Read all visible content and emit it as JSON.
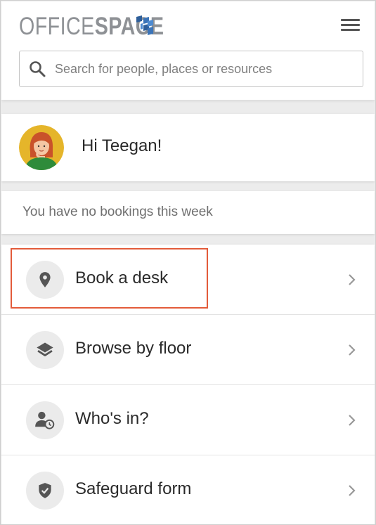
{
  "header": {
    "logo": {
      "text_part1": "OFFICE",
      "text_part2": "SPACE",
      "cube_colors": [
        "#2f5f9a",
        "#3b74b8",
        "#4d8ad0"
      ]
    },
    "menu_icon": "hamburger-menu-icon"
  },
  "search": {
    "placeholder": "Search for people, places or resources",
    "value": "",
    "icon": "search-icon"
  },
  "greeting": {
    "text": "Hi Teegan!",
    "avatar": "avatar-illustration"
  },
  "bookings": {
    "status_text": "You have no bookings this week"
  },
  "menu": {
    "items": [
      {
        "label": "Book a desk",
        "icon": "location-pin-icon",
        "highlighted": true
      },
      {
        "label": "Browse by floor",
        "icon": "layers-icon",
        "highlighted": false
      },
      {
        "label": "Who's in?",
        "icon": "person-clock-icon",
        "highlighted": false
      },
      {
        "label": "Safeguard form",
        "icon": "shield-check-icon",
        "highlighted": false
      }
    ]
  },
  "colors": {
    "highlight_border": "#e35b3a",
    "icon_bg": "#ebebeb",
    "icon_fg": "#555555",
    "logo_gray": "#8e9195",
    "page_bg": "#ececec"
  }
}
